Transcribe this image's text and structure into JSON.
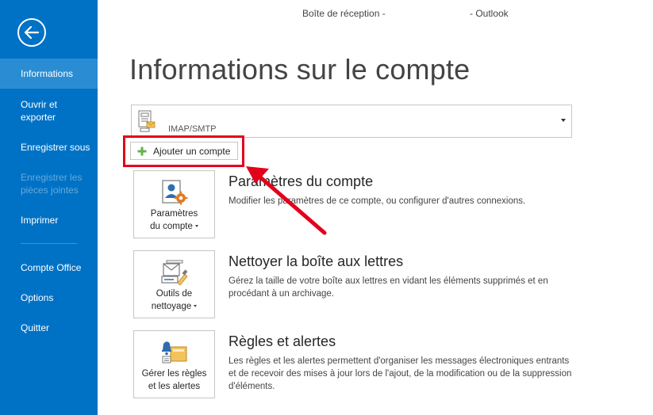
{
  "titlebar": {
    "left": "Boîte de réception -",
    "right": "- Outlook"
  },
  "sidebar": {
    "back_icon": "back-arrow-icon",
    "items": [
      {
        "label": "Informations",
        "active": true
      },
      {
        "label": "Ouvrir et exporter"
      },
      {
        "label": "Enregistrer sous"
      },
      {
        "label": "Enregistrer les pièces jointes",
        "disabled": true
      },
      {
        "label": "Imprimer"
      },
      {
        "label": "Compte Office"
      },
      {
        "label": "Options"
      },
      {
        "label": "Quitter"
      }
    ]
  },
  "main": {
    "title": "Informations sur le compte",
    "account": {
      "type": "IMAP/SMTP",
      "icon": "account-card-icon"
    },
    "add_account": {
      "label": "Ajouter un compte",
      "icon": "plus-icon"
    },
    "sections": [
      {
        "tile_line1": "Paramètres",
        "tile_line2": "du compte",
        "title": "Paramètres du compte",
        "desc": "Modifier les paramètres de ce compte, ou configurer d'autres connexions.",
        "icon": "account-settings-icon"
      },
      {
        "tile_line1": "Outils de",
        "tile_line2": "nettoyage",
        "title": "Nettoyer la boîte aux lettres",
        "desc": "Gérez la taille de votre boîte aux lettres en vidant les éléments supprimés et en procédant à un archivage.",
        "icon": "cleanup-tools-icon"
      },
      {
        "tile_line1": "Gérer les règles",
        "tile_line2": "et les alertes",
        "title": "Règles et alertes",
        "desc": "Les règles et les alertes permettent d'organiser les messages électroniques entrants et de recevoir des mises à jour lors de l'ajout, de la modification ou de la suppression d'éléments.",
        "icon": "rules-alerts-icon"
      }
    ]
  },
  "colors": {
    "sidebar": "#0072c6",
    "sidebar_active": "#2a8dd4",
    "highlight": "#e3001b"
  }
}
